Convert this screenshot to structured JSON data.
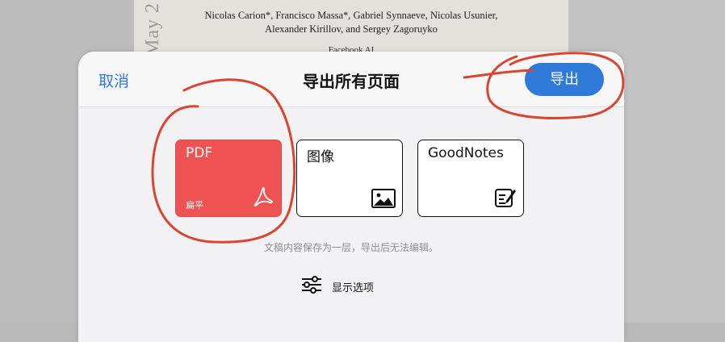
{
  "background_paper": {
    "authors_line1": "Nicolas Carion*, Francisco Massa*, Gabriel Synnaeve, Nicolas Usunier,",
    "authors_line2": "Alexander Kirillov, and Sergey Zagoruyko",
    "affiliation": "Facebook AI",
    "side_text": "May 2"
  },
  "dialog": {
    "cancel_label": "取消",
    "title": "导出所有页面",
    "export_label": "导出",
    "formats": [
      {
        "label": "PDF",
        "sublabel": "扁平",
        "icon": "acrobat-icon",
        "selected": true
      },
      {
        "label": "图像",
        "icon": "image-icon",
        "selected": false
      },
      {
        "label": "GoodNotes",
        "icon": "notebook-pen-icon",
        "selected": false
      }
    ],
    "note": "文稿内容保存为一层，导出后无法编辑。",
    "options_label": "显示选项"
  },
  "colors": {
    "accent": "#2f7ad8",
    "pdf_card": "#ee5252",
    "annotation": "#d9452f"
  }
}
